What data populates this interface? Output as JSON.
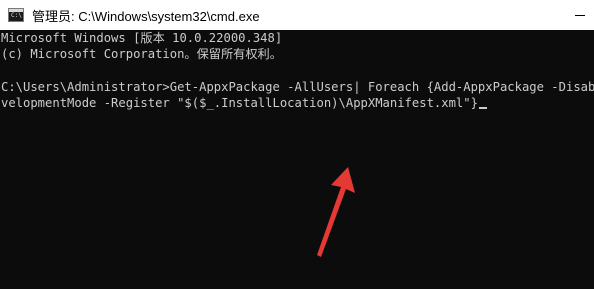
{
  "window": {
    "title": "管理员: C:\\Windows\\system32\\cmd.exe",
    "icon": "cmd-icon",
    "icon_glyph": "C:\\"
  },
  "console": {
    "lines": [
      "Microsoft Windows [版本 10.0.22000.348]",
      "(c) Microsoft Corporation。保留所有权利。",
      "",
      "C:\\Users\\Administrator>Get-AppxPackage -AllUsers| Foreach {Add-AppxPackage -DisableDe",
      "velopmentMode -Register \"$($_.InstallLocation)\\AppXManifest.xml\"}"
    ]
  },
  "annotation": {
    "arrow_color": "#e53935"
  }
}
